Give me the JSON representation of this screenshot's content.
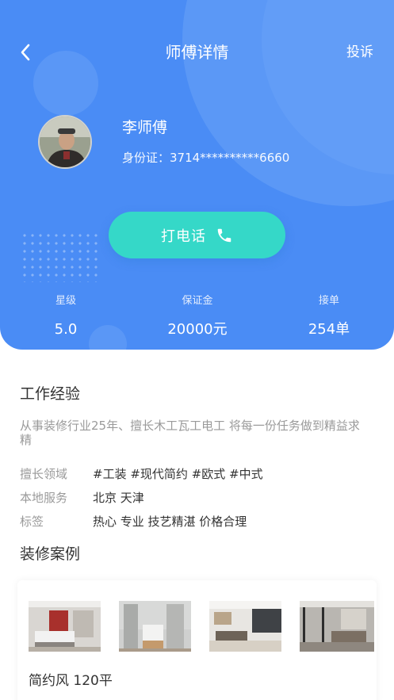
{
  "nav": {
    "title": "师傅详情",
    "complain_label": "投诉"
  },
  "profile": {
    "name": "李师傅",
    "id_card": "身份证：3714**********6660"
  },
  "call_button": {
    "label": "打电话"
  },
  "stats": [
    {
      "key": "星级",
      "value": "5.0"
    },
    {
      "key": "保证金",
      "value": "20000元"
    },
    {
      "key": "接单",
      "value": "254单"
    }
  ],
  "experience": {
    "title": "工作经验",
    "intro": "从事装修行业25年、擅长木工瓦工电工 将每一份任务做到精益求精",
    "rows": [
      {
        "key": "擅长领域",
        "value": "#工装 #现代简约 #欧式 #中式"
      },
      {
        "key": "本地服务",
        "value": "北京 天津"
      },
      {
        "key": "标签",
        "value": "热心 专业 技艺精湛 价格合理"
      }
    ]
  },
  "cases": {
    "title": "装修案例",
    "items": [
      {
        "name": "简约风 120平"
      }
    ]
  },
  "colors": {
    "header_blue": "#4a8cf5",
    "call_teal": "#35d8c8"
  },
  "icons": {
    "back": "chevron-left-icon",
    "phone": "phone-icon"
  }
}
